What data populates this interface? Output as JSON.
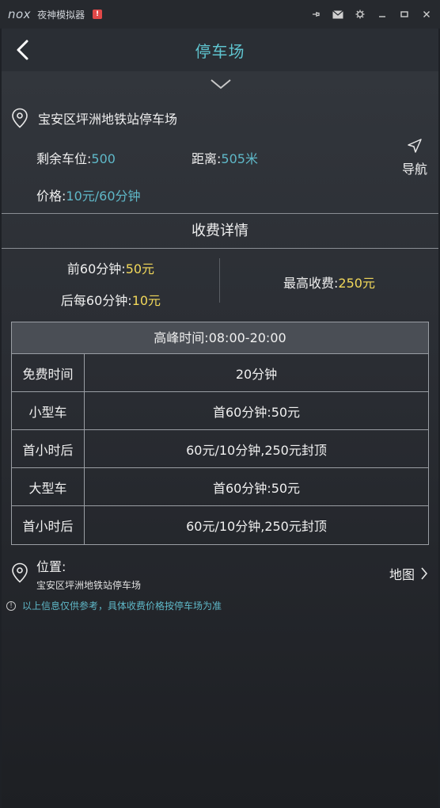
{
  "emulator": {
    "logo": "nox",
    "title": "夜神模拟器",
    "alert": "!"
  },
  "header": {
    "title": "停车场"
  },
  "parking": {
    "name": "宝安区坪洲地铁站停车场",
    "remaining_label": "剩余车位:",
    "remaining_value": "500",
    "distance_label": "距离:",
    "distance_value": "505米",
    "price_label": "价格:",
    "price_value": "10元/60分钟",
    "nav_label": "导航"
  },
  "fee_details": {
    "title": "收费详情",
    "first_label": "前60分钟:",
    "first_value": "50元",
    "after_label": "后每60分钟:",
    "after_value": "10元",
    "max_label": "最高收费:",
    "max_value": "250元"
  },
  "table": {
    "peak": "高峰时间:08:00-20:00",
    "rows": [
      {
        "label": "免费时间",
        "value": "20分钟"
      },
      {
        "label": "小型车",
        "value": "首60分钟:50元"
      },
      {
        "label": "首小时后",
        "value": "60元/10分钟,250元封顶"
      },
      {
        "label": "大型车",
        "value": "首60分钟:50元"
      },
      {
        "label": "首小时后",
        "value": "60元/10分钟,250元封顶"
      }
    ]
  },
  "position": {
    "label": "位置:",
    "address": "宝安区坪洲地铁站停车场",
    "map_label": "地图"
  },
  "notice": {
    "text": "以上信息仅供参考，具体收费价格按停车场为准"
  },
  "colors": {
    "accent_teal": "#5fc4cf",
    "value_blue": "#5fb8c8",
    "value_yellow": "#f2d85a",
    "alert_red": "#e04848"
  }
}
